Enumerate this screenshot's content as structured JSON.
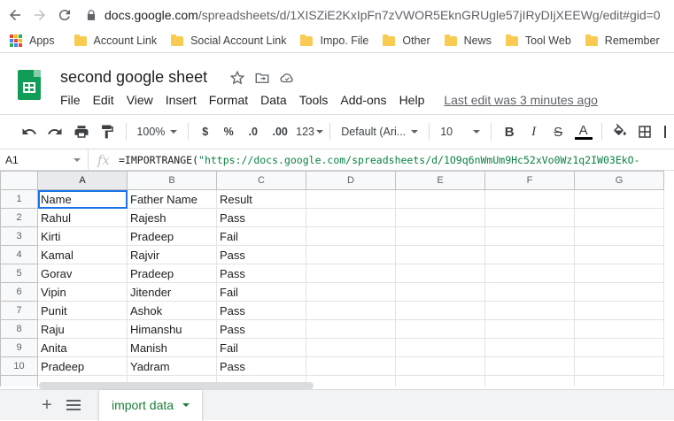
{
  "browser": {
    "url_host": "docs.google.com",
    "url_path": "/spreadsheets/d/1XISZiE2KxIpFn7zVWOR5EknGRUgle57jIRyDIjXEEWg/edit#gid=0",
    "bookmarks": [
      {
        "label": "Apps"
      },
      {
        "label": "Account Link"
      },
      {
        "label": "Social Account Link"
      },
      {
        "label": "Impo. File"
      },
      {
        "label": "Other"
      },
      {
        "label": "News"
      },
      {
        "label": "Tool Web"
      },
      {
        "label": "Remember"
      }
    ]
  },
  "doc": {
    "title": "second google sheet",
    "menu": [
      "File",
      "Edit",
      "View",
      "Insert",
      "Format",
      "Data",
      "Tools",
      "Add-ons",
      "Help"
    ],
    "last_edit": "Last edit was 3 minutes ago"
  },
  "toolbar": {
    "zoom": "100%",
    "currency": "$",
    "percent": "%",
    "dec_decrease": ".0",
    "dec_increase": ".00",
    "more_formats": "123",
    "font": "Default (Ari...",
    "font_size": "10",
    "bold": "B",
    "italic": "I",
    "strike": "S",
    "text_color": "A"
  },
  "formula_bar": {
    "cell_ref": "A1",
    "formula_prefix": "=IMPORTRANGE(",
    "formula_arg": "\"https://docs.google.com/spreadsheets/d/1O9q6nWmUm9Hc52xVo0Wz1q2IW03EkO-"
  },
  "sheet": {
    "columns": [
      "A",
      "B",
      "C",
      "D",
      "E",
      "F",
      "G"
    ],
    "rows": [
      [
        "1",
        "Name",
        "Father Name",
        "Result"
      ],
      [
        "2",
        "Rahul",
        "Rajesh",
        "Pass"
      ],
      [
        "3",
        "Kirti",
        "Pradeep",
        "Fail"
      ],
      [
        "4",
        "Kamal",
        "Rajvir",
        "Pass"
      ],
      [
        "5",
        "Gorav",
        "Pradeep",
        "Pass"
      ],
      [
        "6",
        "Vipin",
        "Jitender",
        "Fail"
      ],
      [
        "7",
        "Punit",
        "Ashok",
        "Pass"
      ],
      [
        "8",
        "Raju",
        "Himanshu",
        "Pass"
      ],
      [
        "9",
        "Anita",
        "Manish",
        "Fail"
      ],
      [
        "10",
        "Pradeep",
        "Yadram",
        "Pass"
      ]
    ]
  },
  "tabs": [
    {
      "label": "import data"
    }
  ]
}
